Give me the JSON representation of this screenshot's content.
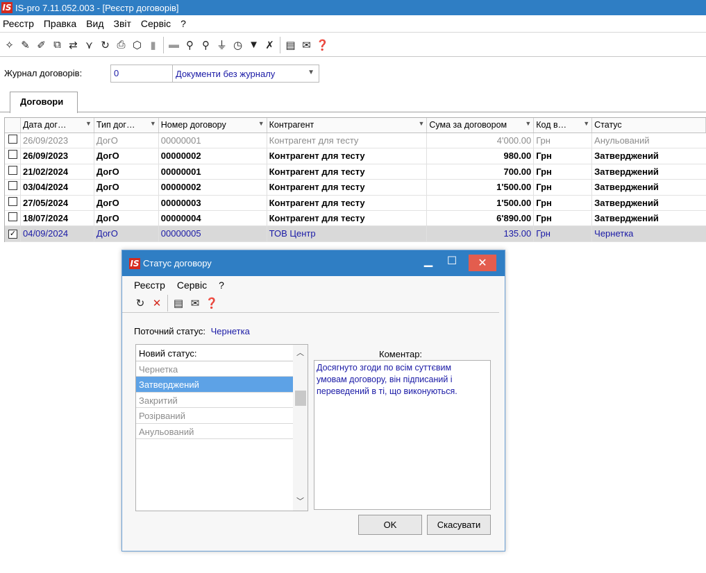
{
  "window": {
    "title": "IS-pro 7.11.052.003 - [Реєстр договорів]",
    "logo": "IS"
  },
  "menu": [
    "Реєстр",
    "Правка",
    "Вид",
    "Звіт",
    "Сервіс",
    "?"
  ],
  "toolbar_icons": [
    "new-doc-icon",
    "new-doc2-icon",
    "new-doc3-icon",
    "copy-icon",
    "move-icon",
    "filter-v-icon",
    "refresh-icon",
    "print-icon",
    "box-icon",
    "dim1-icon",
    "dim2-icon",
    "search-icon",
    "search-next-icon",
    "tree-icon",
    "clock-icon",
    "filter-icon",
    "clear-filter-icon",
    "doc-icon",
    "mail-icon",
    "help-icon"
  ],
  "journal": {
    "label": "Журнал договорів:",
    "code": "0",
    "value": "Документи без журналу"
  },
  "tab": {
    "label": "Договори"
  },
  "table": {
    "columns": [
      "Дата дог…",
      "Тип дог…",
      "Номер договору",
      "Контрагент",
      "Сума за договором",
      "Код в…",
      "Статус"
    ],
    "rows": [
      {
        "checked": false,
        "style": "gray",
        "date": "26/09/2023",
        "type": "ДогО",
        "number": "00000001",
        "counterparty": "Контрагент для тесту",
        "sum": "4'000.00",
        "currency": "Грн",
        "status": "Анульований"
      },
      {
        "checked": false,
        "style": "bold",
        "date": "26/09/2023",
        "type": "ДогО",
        "number": "00000002",
        "counterparty": "Контрагент для тесту",
        "sum": "980.00",
        "currency": "Грн",
        "status": "Затверджений"
      },
      {
        "checked": false,
        "style": "bold",
        "date": "21/02/2024",
        "type": "ДогО",
        "number": "00000001",
        "counterparty": "Контрагент для тесту",
        "sum": "700.00",
        "currency": "Грн",
        "status": "Затверджений"
      },
      {
        "checked": false,
        "style": "bold",
        "date": "03/04/2024",
        "type": "ДогО",
        "number": "00000002",
        "counterparty": "Контрагент для тесту",
        "sum": "1'500.00",
        "currency": "Грн",
        "status": "Затверджений"
      },
      {
        "checked": false,
        "style": "bold",
        "date": "27/05/2024",
        "type": "ДогО",
        "number": "00000003",
        "counterparty": "Контрагент для тесту",
        "sum": "1'500.00",
        "currency": "Грн",
        "status": "Затверджений"
      },
      {
        "checked": false,
        "style": "bold",
        "date": "18/07/2024",
        "type": "ДогО",
        "number": "00000004",
        "counterparty": "Контрагент для тесту",
        "sum": "6'890.00",
        "currency": "Грн",
        "status": "Затверджений"
      },
      {
        "checked": true,
        "style": "sel",
        "date": "04/09/2024",
        "type": "ДогО",
        "number": "00000005",
        "counterparty": "ТОВ Центр",
        "sum": "135.00",
        "currency": "Грн",
        "status": "Чернетка"
      }
    ]
  },
  "dialog": {
    "title": "Статус договору",
    "menu": [
      "Реєстр",
      "Сервіс",
      "?"
    ],
    "current_status_label": "Поточний статус:",
    "current_status_value": "Чернетка",
    "new_status_header": "Новий статус:",
    "statuses": [
      "Чернетка",
      "Затверджений",
      "Закритий",
      "Розірваний",
      "Анульований"
    ],
    "selected_index": 1,
    "comment_label": "Коментар:",
    "comment_text": "Досягнуто згоди по всім суттєвим\nумовам договору, він підписаний і\nпереведений в ті, що виконуються.",
    "ok_label": "OK",
    "cancel_label": "Скасувати"
  }
}
